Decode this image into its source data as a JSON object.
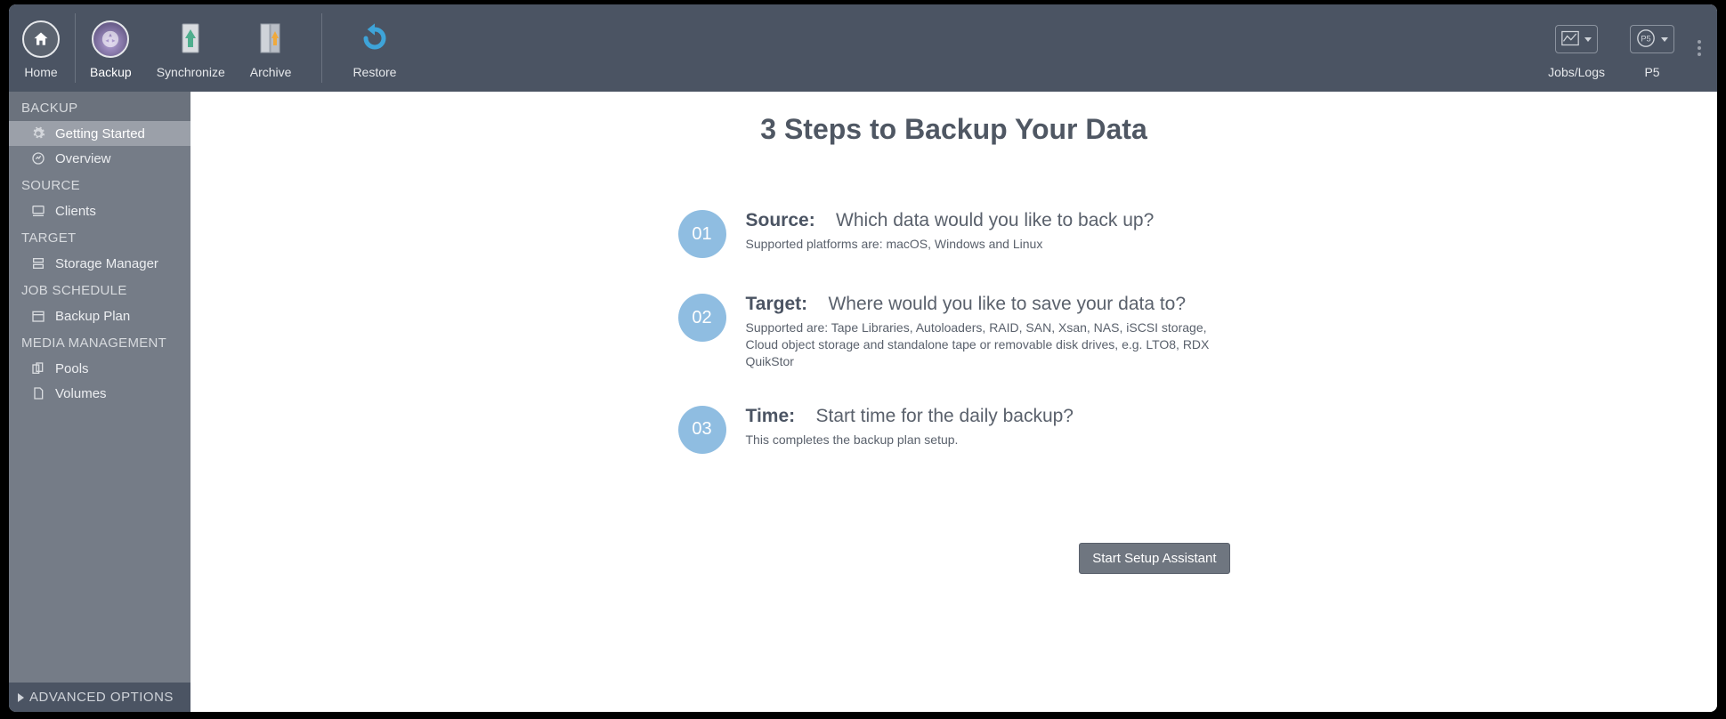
{
  "toolbar": {
    "home": "Home",
    "backup": "Backup",
    "synchronize": "Synchronize",
    "archive": "Archive",
    "restore": "Restore",
    "jobs_logs": "Jobs/Logs",
    "p5": "P5"
  },
  "sidebar": {
    "sections": [
      {
        "header": "BACKUP",
        "items": [
          {
            "label": "Getting Started",
            "active": true
          },
          {
            "label": "Overview"
          }
        ]
      },
      {
        "header": "SOURCE",
        "items": [
          {
            "label": "Clients"
          }
        ]
      },
      {
        "header": "TARGET",
        "items": [
          {
            "label": "Storage Manager"
          }
        ]
      },
      {
        "header": "JOB SCHEDULE",
        "items": [
          {
            "label": "Backup Plan"
          }
        ]
      },
      {
        "header": "MEDIA MANAGEMENT",
        "items": [
          {
            "label": "Pools"
          },
          {
            "label": "Volumes"
          }
        ]
      }
    ],
    "advanced": "ADVANCED OPTIONS"
  },
  "content": {
    "title": "3 Steps to Backup Your Data",
    "steps": [
      {
        "num": "01",
        "label": "Source:",
        "question": "Which data would you like to back up?",
        "detail": "Supported platforms are: macOS, Windows and Linux"
      },
      {
        "num": "02",
        "label": "Target:",
        "question": "Where would you like to save your data to?",
        "detail": "Supported are: Tape Libraries, Autoloaders, RAID, SAN, Xsan, NAS, iSCSI storage, Cloud object storage and standalone tape or removable disk drives, e.g. LTO8, RDX QuikStor"
      },
      {
        "num": "03",
        "label": "Time:",
        "question": "Start time for the daily backup?",
        "detail": "This completes the backup plan setup."
      }
    ],
    "cta": "Start Setup Assistant"
  }
}
